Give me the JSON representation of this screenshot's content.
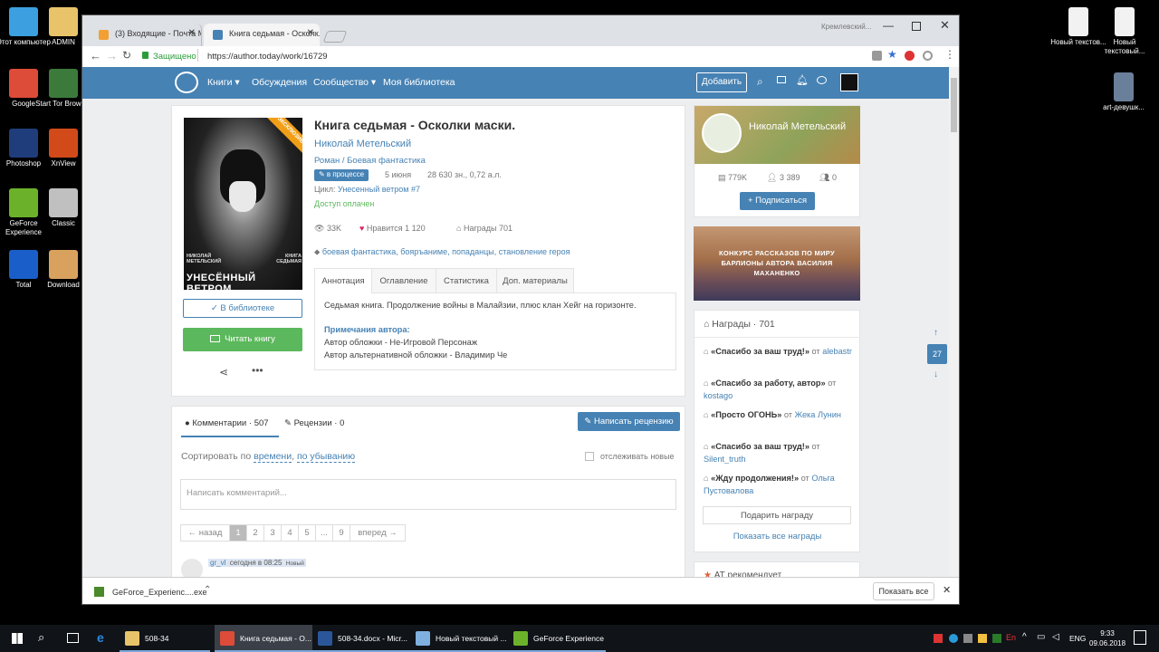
{
  "desktop": {
    "left_icons": [
      {
        "label": "Этот компьютер",
        "color": "#3b9fe0"
      },
      {
        "label": "ADMIN",
        "color": "#e8c36a"
      },
      {
        "label": "Google",
        "color": "#dd4b39"
      },
      {
        "label": "Start Tor Browser",
        "color": "#3c7a3c"
      },
      {
        "label": "Photoshop",
        "color": "#1f3d7a"
      },
      {
        "label": "XnView",
        "color": "#d24a1a"
      },
      {
        "label": "GeForce Experience",
        "color": "#6bb22a"
      },
      {
        "label": "Classic",
        "color": "#c0c0c0"
      },
      {
        "label": "Total",
        "color": "#1a5fc9"
      },
      {
        "label": "Download",
        "color": "#d8a25e"
      }
    ],
    "right_icons": [
      {
        "label": "Новый текстов...",
        "color": "#f2f2f2"
      },
      {
        "label": "Новый текстовый...",
        "color": "#f2f2f2"
      },
      {
        "label": "art-девушк...",
        "color": "#6a7f9a"
      }
    ]
  },
  "browser": {
    "tabs": [
      {
        "title": "(3) Входящие - Почта M...",
        "active": false
      },
      {
        "title": "Книга седьмая - Осколк...",
        "active": true
      }
    ],
    "profile": "Кремлевский...",
    "secure_label": "Защищено",
    "url": "https://author.today/work/16729"
  },
  "site": {
    "nav": {
      "books": "Книги",
      "discussions": "Обсуждения",
      "community": "Сообщество",
      "library": "Моя библиотека",
      "add_button": "Добавить"
    },
    "book": {
      "title": "Книга седьмая - Осколки маски.",
      "author": "Николай Метельский",
      "genres": "Роман / Боевая фантастика",
      "status_badge": "в процессе",
      "date": "5 июня",
      "size": "28 630 зн., 0,72 а.л.",
      "cycle_label": "Цикл:",
      "cycle": "Унесенный ветром #7",
      "access": "Доступ оплачен",
      "views": "33K",
      "likes_label": "Нравится",
      "likes": "1 120",
      "awards_label": "Награды",
      "awards": "701",
      "tags": "боевая фантастика, бояръаниме, попаданцы, становление героя",
      "cover_ribbon": "ЭКСКЛЮЗИВ",
      "cover_author": "НИКОЛАЙ МЕТЕЛЬСКИЙ",
      "cover_book": "КНИГА СЕДЬМАЯ",
      "cover_title": "УНЕСЁННЫЙ ВЕТРОМ",
      "in_library": "В библиотеке",
      "read_book": "Читать книгу"
    },
    "tabs": [
      "Аннотация",
      "Оглавление",
      "Статистика",
      "Доп. материалы"
    ],
    "annotation": "Седьмая книга. Продолжение войны в Малайзии, плюс клан Хейг на горизонте.",
    "notes_title": "Примечания автора:",
    "notes": [
      "Автор обложки - Не-Игровой Персонаж",
      "Автор альтернативной обложки - Владимир Че"
    ],
    "comments": {
      "comments_label": "Комментарии",
      "comments_count": "507",
      "reviews_label": "Рецензии",
      "reviews_count": "0",
      "write_review": "Написать рецензию",
      "sort_prefix": "Сортировать по",
      "sort_by": "времени",
      "sort_sep": ",",
      "sort_order": "по убыванию",
      "track": "отслеживать новые",
      "placeholder": "Написать комментарий...",
      "pages": [
        "← назад",
        "1",
        "2",
        "3",
        "4",
        "5",
        "...",
        "9",
        "вперед →"
      ],
      "first_user": "gr_vl",
      "first_time": "сегодня в 08:25",
      "first_badge": "Новый"
    },
    "sidebar": {
      "author_name": "Николай Метельский",
      "stat_books": "779K",
      "stat_followers": "3 389",
      "stat_other": "0",
      "subscribe": "Подписаться",
      "banner_text": "КОНКУРС РАССКАЗОВ ПО МИРУ БАРЛИОНЫ АВТОРА ВАСИЛИЯ МАХАНЕНКО",
      "awards_title": "Награды",
      "awards_count": "701",
      "awards": [
        {
          "title": "«Спасибо за ваш труд!»",
          "from": "от",
          "user": "alebastr"
        },
        {
          "title": "«Спасибо за работу, автор»",
          "from": "от",
          "user": "kostago"
        },
        {
          "title": "«Просто ОГОНЬ»",
          "from": "от",
          "user": "Жека Лунин"
        },
        {
          "title": "«Спасибо за ваш труд!»",
          "from": "от",
          "user": "Silent_truth"
        },
        {
          "title": "«Жду продолжения!»",
          "from": "от",
          "user": "Ольга Пустовалова"
        }
      ],
      "give_award": "Подарить награду",
      "show_all": "Показать все награды",
      "recommend": "АТ рекомендует"
    },
    "side_counter": "27"
  },
  "download_bar": {
    "file": "GeForce_Experienc....exe",
    "show_all": "Показать все"
  },
  "taskbar": {
    "items": [
      "508-34",
      "Книга седьмая - О...",
      "508-34.docx - Micr...",
      "Новый текстовый ...",
      "GeForce Experience"
    ],
    "lang": "ENG",
    "time": "9:33",
    "date": "09.06.2018"
  }
}
